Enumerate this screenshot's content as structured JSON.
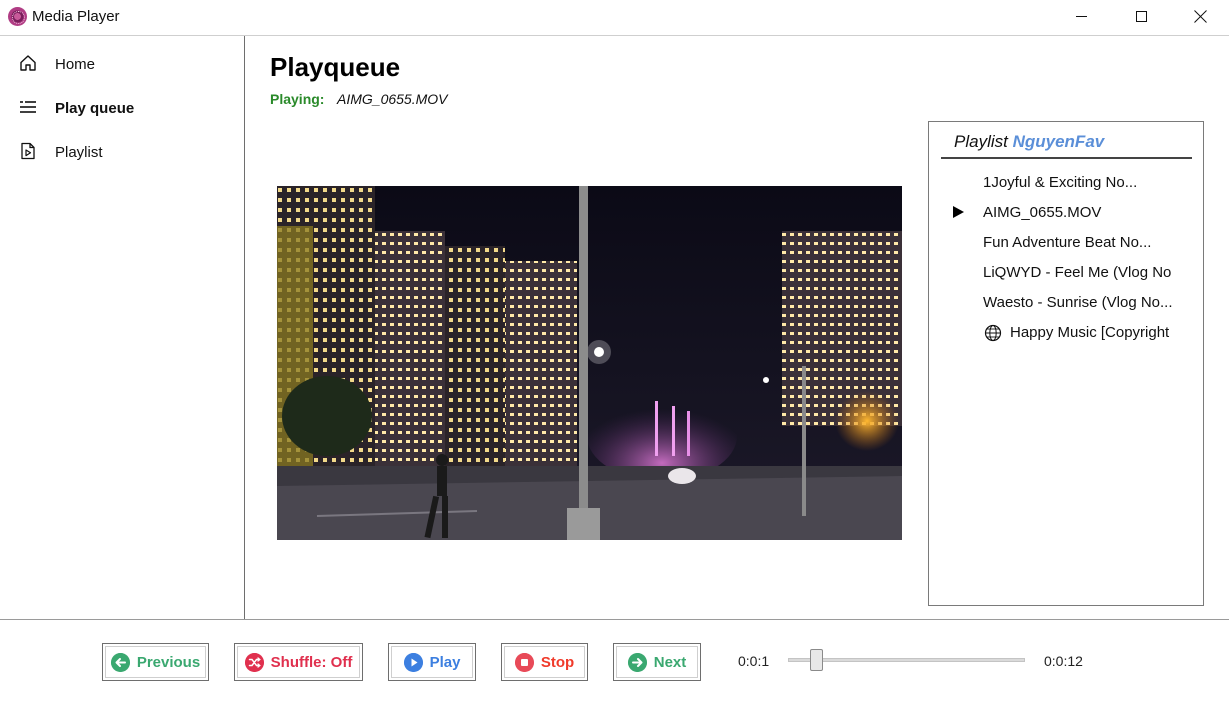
{
  "window": {
    "title": "Media Player",
    "icons": {
      "app": "media-player-app-icon",
      "minimize": "minimize-icon",
      "maximize": "maximize-icon",
      "close": "close-icon"
    }
  },
  "sidebar": {
    "items": [
      {
        "label": "Home",
        "icon": "home-icon",
        "active": false
      },
      {
        "label": "Play queue",
        "icon": "queue-list-icon",
        "active": true
      },
      {
        "label": "Playlist",
        "icon": "playlist-file-icon",
        "active": false
      }
    ]
  },
  "main": {
    "title": "Playqueue",
    "playing_label": "Playing:",
    "playing_value": "AIMG_0655.MOV"
  },
  "playlist": {
    "header_prefix": "Playlist",
    "name": "NguyenFav",
    "name_color": "#5b8fd8",
    "current_index": 1,
    "tracks": [
      "1Joyful & Exciting No...",
      "AIMG_0655.MOV",
      "Fun Adventure Beat No...",
      "LiQWYD - Feel Me (Vlog No",
      "Waesto - Sunrise (Vlog No...",
      "Happy Music [Copyright"
    ]
  },
  "controls": {
    "previous": {
      "label": "Previous",
      "icon": "arrow-left-circle-icon",
      "color": "#3aa870"
    },
    "shuffle": {
      "label": "Shuffle: Off",
      "icon": "shuffle-circle-icon",
      "color": "#e0304e"
    },
    "play": {
      "label": "Play",
      "icon": "play-circle-icon",
      "color": "#3c7fe0"
    },
    "stop": {
      "label": "Stop",
      "icon": "stop-circle-icon",
      "color": "#f03a2a"
    },
    "next": {
      "label": "Next",
      "icon": "arrow-right-circle-icon",
      "color": "#3aa870"
    }
  },
  "timeline": {
    "current": "0:0:1",
    "total": "0:0:12",
    "position_fraction": 0.1
  }
}
